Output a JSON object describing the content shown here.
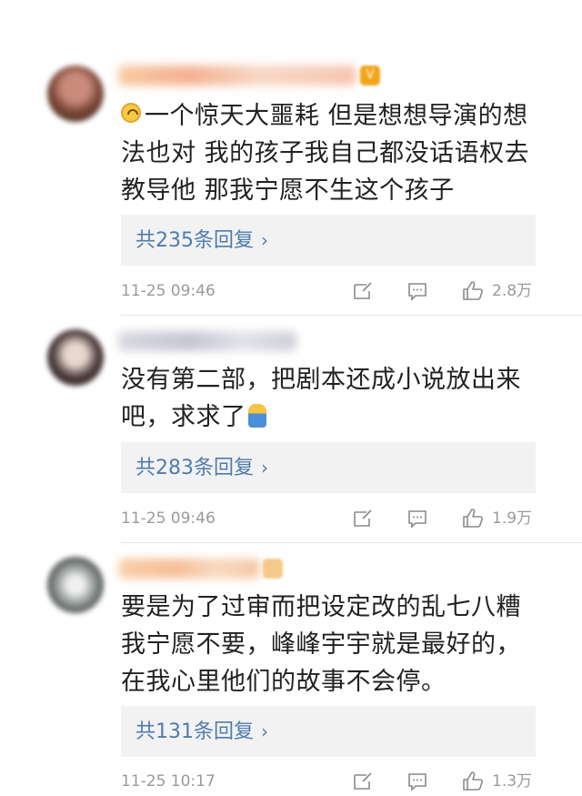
{
  "comments": [
    {
      "text_lines": [
        "一个惊天大噩耗 但是想想导演的想",
        "法也对 我的孩子我自己都没话语权去",
        "教导他 那我宁愿不生这个孩子"
      ],
      "reply_label": "共235条回复",
      "time": "11-25 09:46",
      "likes": "2.8万"
    },
    {
      "text_lines": [
        "没有第二部，把剧本还成小说放出来",
        "吧，求求了"
      ],
      "reply_label": "共283条回复",
      "time": "11-25 09:46",
      "likes": "1.9万"
    },
    {
      "text_lines": [
        "要是为了过审而把设定改的乱七八糟",
        "我宁愿不要，峰峰宇宇就是最好的，",
        "在我心里他们的故事不会停。"
      ],
      "reply_label": "共131条回复",
      "time": "11-25 10:17",
      "likes": "1.3万"
    }
  ],
  "icons": {
    "first_line_emoji": "upside-down-face-icon",
    "second_comment_emoji": "kneeling-person-icon",
    "repost": "repost-icon",
    "comment": "comment-icon",
    "like": "thumbs-up-icon",
    "reply_chevron": "chevron-right-icon"
  },
  "colors": {
    "reply_link": "#4f7cae",
    "meta": "#9a9a9a",
    "reply_bg": "#f2f2f2"
  }
}
